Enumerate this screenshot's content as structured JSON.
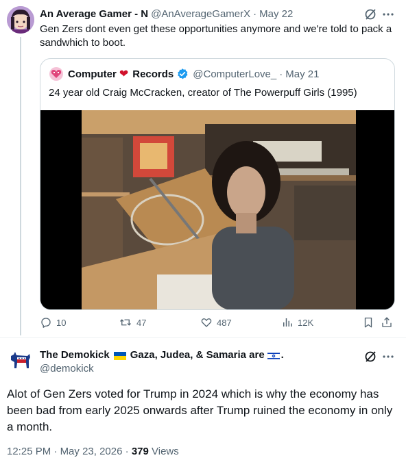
{
  "quoting_tweet": {
    "author_name": "An Average Gamer - N",
    "author_handle": "@AnAverageGamerX",
    "separator": "·",
    "date": "May 22",
    "text": "Gen Zers dont even get these opportunities anymore and we're told to pack a sandwhich to boot.",
    "quoted_tweet": {
      "author_name_part1": "Computer",
      "heart_icon": "❤",
      "author_name_part2": "Records",
      "author_handle": "@ComputerLove_",
      "separator": "·",
      "date": "May 21",
      "text": "24 year old Craig McCracken, creator of The Powerpuff Girls (1995)",
      "media": "video-thumbnail"
    },
    "actions": {
      "replies": "10",
      "reposts": "47",
      "likes": "487",
      "views": "12K"
    }
  },
  "main_tweet": {
    "author_name": "The Demokick",
    "name_suffix": "Gaza, Judea, & Samaria are",
    "name_end": ".",
    "author_handle": "@demokick",
    "text": "Alot of Gen Zers voted for Trump in 2024 which is why the economy has been bad from early 2025 onwards after Trump ruined the economy in only a month.",
    "time": "12:25 PM",
    "separator1": "·",
    "date": "May 23, 2026",
    "separator2": "·",
    "views_count": "379",
    "views_label": "Views"
  },
  "colors": {
    "text_primary": "#0f1419",
    "text_secondary": "#536471",
    "border": "#cfd9de",
    "verified_blue": "#1d9bf0",
    "heart_red": "#d0112b"
  },
  "icons": [
    "grok-icon",
    "more-icon",
    "reply-icon",
    "repost-icon",
    "like-icon",
    "views-icon",
    "bookmark-icon",
    "share-icon",
    "verified-icon",
    "ukraine-flag-icon",
    "israel-flag-icon"
  ]
}
